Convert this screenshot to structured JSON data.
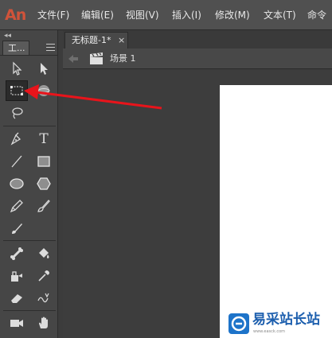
{
  "app": {
    "logo": "An"
  },
  "menu": [
    "文件(F)",
    "编辑(E)",
    "视图(V)",
    "插入(I)",
    "修改(M)",
    "文本(T)",
    "命令"
  ],
  "tools_panel": {
    "collapse": "◂◂",
    "tab": "工..."
  },
  "tools": [
    {
      "name": "selection-tool",
      "icon": "selection-arrow-icon"
    },
    {
      "name": "subselection-tool",
      "icon": "subselection-arrow-icon"
    },
    {
      "name": "free-transform-tool",
      "icon": "free-transform-icon",
      "selected": true
    },
    {
      "name": "3d-rotation-tool",
      "icon": "3d-rotation-icon"
    },
    {
      "name": "lasso-tool",
      "icon": "lasso-icon"
    },
    {
      "name": "pen-tool",
      "icon": "pen-icon"
    },
    {
      "name": "text-tool",
      "icon": "text-icon",
      "glyph": "T"
    },
    {
      "name": "line-tool",
      "icon": "line-icon"
    },
    {
      "name": "rectangle-tool",
      "icon": "rectangle-icon"
    },
    {
      "name": "oval-tool",
      "icon": "oval-icon"
    },
    {
      "name": "polystar-tool",
      "icon": "polystar-icon"
    },
    {
      "name": "pencil-tool",
      "icon": "pencil-icon"
    },
    {
      "name": "paint-brush-tool",
      "icon": "paint-brush-icon"
    },
    {
      "name": "brush-tool",
      "icon": "brush-icon"
    },
    {
      "name": "bone-tool",
      "icon": "bone-icon"
    },
    {
      "name": "paint-bucket-tool",
      "icon": "paint-bucket-icon"
    },
    {
      "name": "ink-bottle-tool",
      "icon": "ink-bottle-icon"
    },
    {
      "name": "eyedropper-tool",
      "icon": "eyedropper-icon"
    },
    {
      "name": "eraser-tool",
      "icon": "eraser-icon"
    },
    {
      "name": "width-tool",
      "icon": "width-icon"
    },
    {
      "name": "camera-tool",
      "icon": "camera-icon"
    },
    {
      "name": "hand-tool",
      "icon": "hand-icon"
    }
  ],
  "document": {
    "tab_title": "无标题-1*",
    "tab_close": "×",
    "scene": "场景 1"
  },
  "watermark": {
    "title": "易采站长站",
    "subtitle": "www.easck.com"
  },
  "colors": {
    "logo": "#d0533a",
    "annotation_arrow": "#e8141b",
    "watermark_blue": "#1d73c9"
  }
}
